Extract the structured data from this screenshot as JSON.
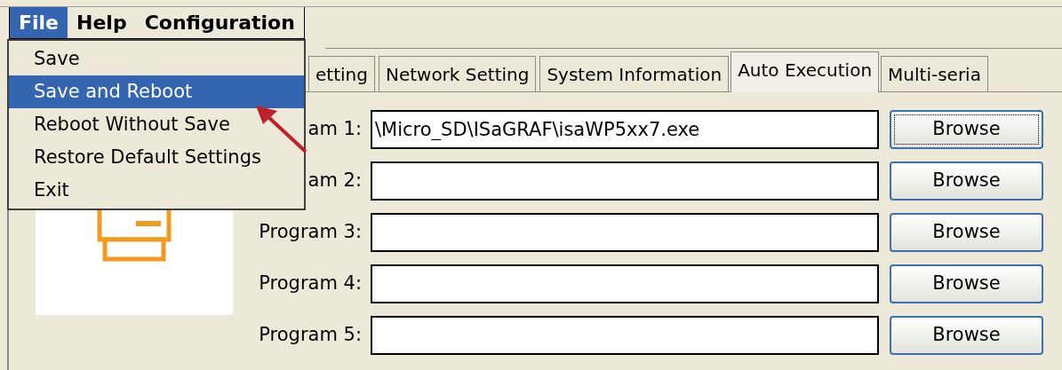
{
  "menu_bar": {
    "items": [
      {
        "label": "File",
        "selected": true
      },
      {
        "label": "Help",
        "selected": false
      },
      {
        "label": "Configuration",
        "selected": false
      }
    ]
  },
  "file_menu": {
    "items": [
      {
        "label": "Save",
        "selected": false
      },
      {
        "label": "Save and Reboot",
        "selected": true
      },
      {
        "label": "Reboot Without Save",
        "selected": false
      },
      {
        "label": "Restore Default Settings",
        "selected": false
      },
      {
        "label": "Exit",
        "selected": false
      }
    ]
  },
  "tabs": [
    {
      "label": "etting",
      "selected": false
    },
    {
      "label": "Network Setting",
      "selected": false
    },
    {
      "label": "System Information",
      "selected": false
    },
    {
      "label": "Auto Execution",
      "selected": true
    },
    {
      "label": "Multi-seria",
      "selected": false
    }
  ],
  "programs": [
    {
      "label": "am 1:",
      "value": "\\Micro_SD\\ISaGRAF\\isaWP5xx7.exe",
      "button": "Browse",
      "focused": true
    },
    {
      "label": "am 2:",
      "button": "Browse",
      "focused": false
    },
    {
      "label": "Program 3:",
      "button": "Browse",
      "focused": false
    },
    {
      "label": "Program 4:",
      "button": "Browse",
      "focused": false
    },
    {
      "label": "Program 5:",
      "button": "Browse",
      "focused": false
    }
  ]
}
